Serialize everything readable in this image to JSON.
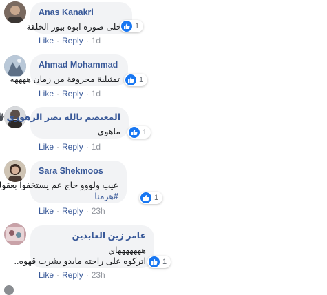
{
  "comments": [
    {
      "author": "Anas Kanakri",
      "lines": [
        "احلى صوره ابوه بيوز الخلقة"
      ],
      "reactions": "1",
      "like_label": "Like",
      "reply_label": "Reply",
      "time": "1d"
    },
    {
      "author": "Ahmad Mohammad",
      "lines": [
        "تمثيلية محروقة من زمان ههههه"
      ],
      "reactions": "1",
      "like_label": "Like",
      "reply_label": "Reply",
      "time": "1d"
    },
    {
      "author": "المعتصم بالله نصر الزهوري",
      "lines": [
        "ماهوي"
      ],
      "reactions": "1",
      "like_label": "Like",
      "reply_label": "Reply",
      "time": "1d"
    },
    {
      "author": "Sara Shekmoos",
      "lines": [
        "عيب ولووو حاج عم يستخفوا بعقولنا"
      ],
      "hashtag": "#هرمنا",
      "reactions": "1",
      "like_label": "Like",
      "reply_label": "Reply",
      "time": "23h"
    },
    {
      "author": "عامر زين العابدين",
      "lines": [
        "هههههههاي",
        "اتركوه على راحته مابدو يشرب قهوه.."
      ],
      "reactions": "1",
      "like_label": "Like",
      "reply_label": "Reply",
      "time": "23h"
    }
  ],
  "colors": {
    "link": "#385898",
    "bubble": "#f2f3f5",
    "like_blue": "#1877f2",
    "meta_gray": "#90949c"
  },
  "icons": [
    "avatar",
    "like-icon",
    "waving-hand-icon"
  ]
}
